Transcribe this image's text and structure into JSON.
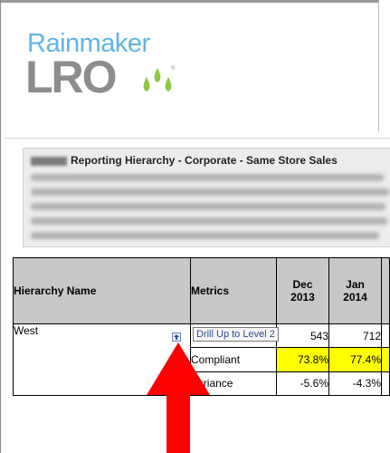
{
  "logo": {
    "top_text": "Rainmaker",
    "bottom_text": "LRO",
    "mark": "®"
  },
  "report": {
    "title": "Reporting Hierarchy - Corporate - Same Store Sales"
  },
  "table": {
    "headers": {
      "hierarchy": "Hierarchy Name",
      "metrics": "Metrics",
      "months": [
        {
          "line1": "Dec",
          "line2": "2013"
        },
        {
          "line1": "Jan",
          "line2": "2014"
        }
      ]
    },
    "row": {
      "name": "West",
      "tooltip": "Drill Up to Level 2",
      "metrics": [
        {
          "label": "",
          "values": [
            "543",
            "712"
          ],
          "highlight": false
        },
        {
          "label": "Compliant",
          "values": [
            "73.8%",
            "77.4%"
          ],
          "highlight": true
        },
        {
          "label": "Variance",
          "values": [
            "-5.6%",
            "-4.3%"
          ],
          "highlight": false
        }
      ]
    }
  },
  "colors": {
    "highlight": "#ffff00",
    "header_bg": "#c8c8c8",
    "arrow": "#ff0000",
    "logo_blue": "#5fb6e3",
    "logo_gray": "#8d8d8d"
  }
}
